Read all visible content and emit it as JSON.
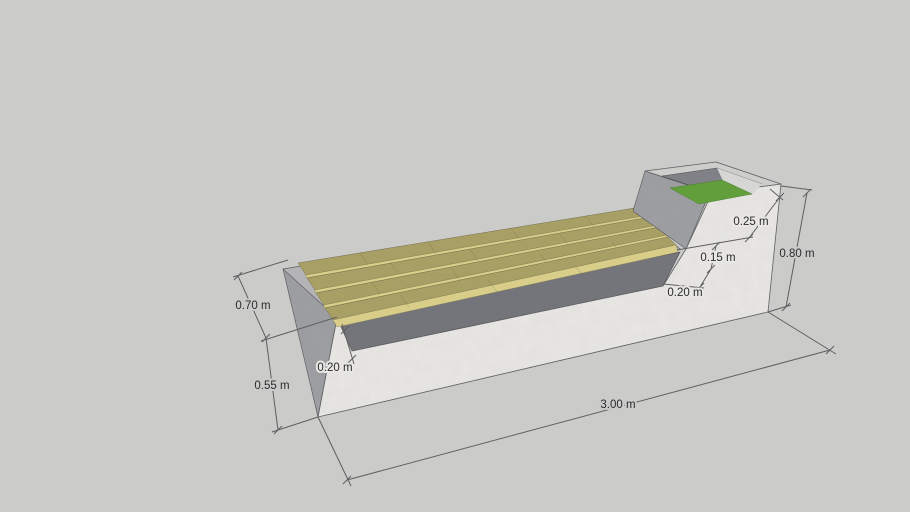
{
  "colors": {
    "bg": "#cbcbca",
    "concrete-light": "#e8e7e4",
    "concrete-top": "#b4b5b7",
    "concrete-shadow": "#9b9ca0",
    "recess-shadow": "#73757a",
    "planter-rim": "#d0d0ce",
    "planter-inner": "#808186",
    "planter-inner-lit": "#d6d6d4",
    "grass": "#5e9d33",
    "wood-top": "#aaa164",
    "wood-edge": "#d8ce8a",
    "dim-line": "#5f5f5f",
    "dim-text": "#2b2b2b"
  },
  "model": {
    "dimensions": {
      "dim_070": {
        "label": "0.70 m",
        "value_m": 0.7
      },
      "dim_055": {
        "label": "0.55 m",
        "value_m": 0.55
      },
      "dim_020_left": {
        "label": "0.20 m",
        "value_m": 0.2
      },
      "dim_300": {
        "label": "3.00 m",
        "value_m": 3.0
      },
      "dim_025": {
        "label": "0.25 m",
        "value_m": 0.25
      },
      "dim_015": {
        "label": "0.15 m",
        "value_m": 0.15
      },
      "dim_020_right": {
        "label": "0.20 m",
        "value_m": 0.2
      },
      "dim_080": {
        "label": "0.80 m",
        "value_m": 0.8
      }
    }
  }
}
